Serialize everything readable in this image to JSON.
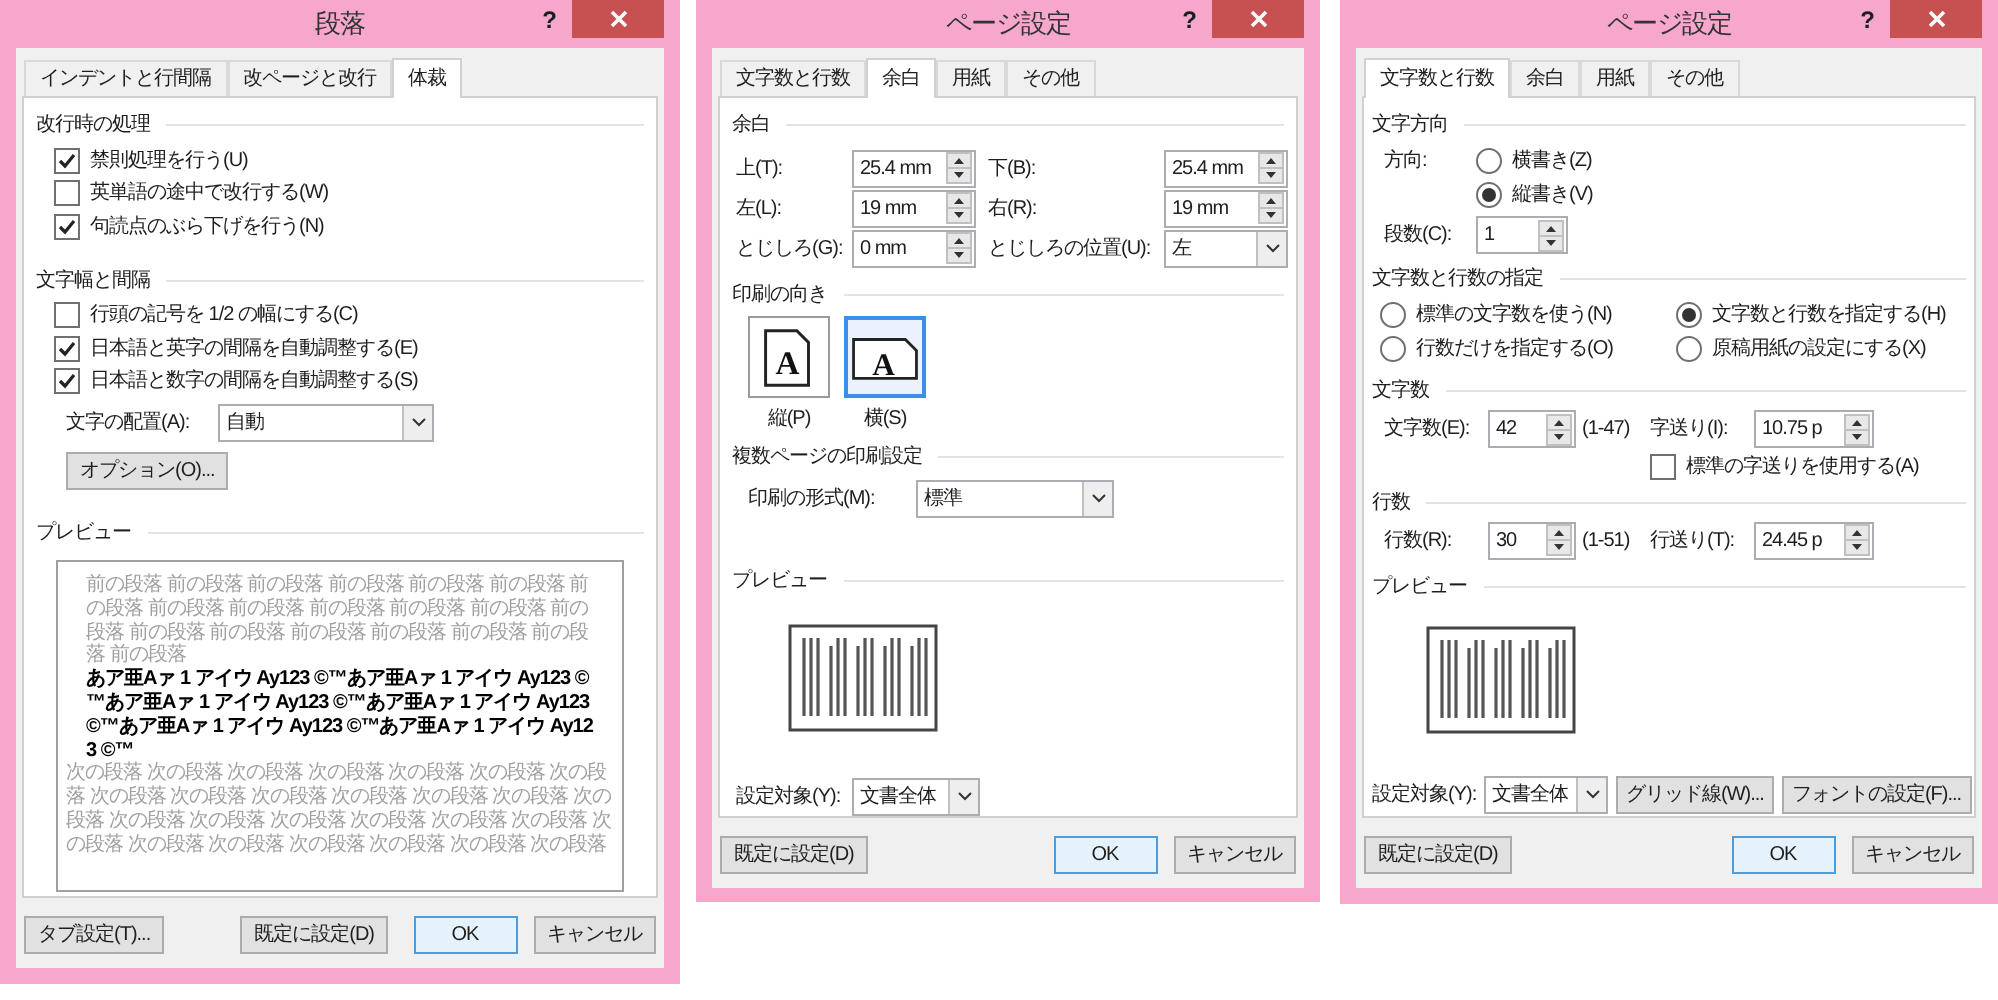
{
  "paragraph_dialog": {
    "title": "段落",
    "help": "?",
    "tabs": [
      {
        "label": "インデントと行間隔",
        "selected": false
      },
      {
        "label": "改ページと改行",
        "selected": false
      },
      {
        "label": "体裁",
        "selected": true
      }
    ],
    "line_break": {
      "heading": "改行時の処理",
      "options": [
        {
          "label": "禁則処理を行う(U)",
          "checked": true
        },
        {
          "label": "英単語の途中で改行する(W)",
          "checked": false
        },
        {
          "label": "句読点のぶら下げを行う(N)",
          "checked": true
        }
      ]
    },
    "width_spacing": {
      "heading": "文字幅と間隔",
      "options": [
        {
          "label": "行頭の記号を 1/2 の幅にする(C)",
          "checked": false
        },
        {
          "label": "日本語と英字の間隔を自動調整する(E)",
          "checked": true
        },
        {
          "label": "日本語と数字の間隔を自動調整する(S)",
          "checked": true
        }
      ]
    },
    "alignment": {
      "label": "文字の配置(A):",
      "value": "自動"
    },
    "option_button": "オプション(O)...",
    "preview": {
      "heading": "プレビュー",
      "before": "前の段落 前の段落 前の段落 前の段落 前の段落 前の段落 前の段落 前の段落 前の段落 前の段落 前の段落 前の段落 前の段落 前の段落 前の段落 前の段落 前の段落 前の段落 前の段落 前の段落",
      "sample": "あア亜Aァ 1 アイウ Ay123 ©™あア亜Aァ 1 アイウ Ay123 ©™あア亜Aァ 1 アイウ Ay123 ©™あア亜Aァ 1 アイウ Ay123 ©™あア亜Aァ 1 アイウ Ay123 ©™あア亜Aァ 1 アイウ Ay123 ©™",
      "after": "次の段落 次の段落 次の段落 次の段落 次の段落 次の段落 次の段落 次の段落 次の段落 次の段落 次の段落 次の段落 次の段落 次の段落 次の段落 次の段落 次の段落 次の段落 次の段落 次の段落 次の段落 次の段落 次の段落 次の段落 次の段落 次の段落 次の段落"
    },
    "buttons": [
      {
        "label": "タブ設定(T)...",
        "kind": "normal"
      },
      {
        "label": "既定に設定(D)",
        "kind": "normal"
      },
      {
        "label": "OK",
        "kind": "default"
      },
      {
        "label": "キャンセル",
        "kind": "normal"
      }
    ]
  },
  "margins_dialog": {
    "title": "ページ設定",
    "help": "?",
    "tabs": [
      {
        "label": "文字数と行数",
        "selected": false
      },
      {
        "label": "余白",
        "selected": true
      },
      {
        "label": "用紙",
        "selected": false
      },
      {
        "label": "その他",
        "selected": false
      }
    ],
    "margins": {
      "heading": "余白",
      "fields": [
        {
          "label": "上(T):",
          "value": "25.4 mm",
          "kind": "spin"
        },
        {
          "label": "下(B):",
          "value": "25.4 mm",
          "kind": "spin"
        },
        {
          "label": "左(L):",
          "value": "19 mm",
          "kind": "spin"
        },
        {
          "label": "右(R):",
          "value": "19 mm",
          "kind": "spin"
        },
        {
          "label": "とじしろ(G):",
          "value": "0 mm",
          "kind": "spin"
        },
        {
          "label": "とじしろの位置(U):",
          "value": "左",
          "kind": "select"
        }
      ]
    },
    "orientation": {
      "heading": "印刷の向き",
      "options": [
        {
          "label": "縦(P)",
          "glyph": "A",
          "kind": "portrait",
          "selected": false
        },
        {
          "label": "横(S)",
          "glyph": "A",
          "kind": "landscape",
          "selected": true
        }
      ]
    },
    "multiple_pages": {
      "heading": "複数ページの印刷設定",
      "label": "印刷の形式(M):",
      "value": "標準"
    },
    "preview": {
      "heading": "プレビュー"
    },
    "apply_to": {
      "label": "設定対象(Y):",
      "value": "文書全体"
    },
    "buttons": [
      {
        "label": "既定に設定(D)",
        "kind": "normal"
      },
      {
        "label": "OK",
        "kind": "default"
      },
      {
        "label": "キャンセル",
        "kind": "normal"
      }
    ]
  },
  "grid_dialog": {
    "title": "ページ設定",
    "help": "?",
    "tabs": [
      {
        "label": "文字数と行数",
        "selected": true
      },
      {
        "label": "余白",
        "selected": false
      },
      {
        "label": "用紙",
        "selected": false
      },
      {
        "label": "その他",
        "selected": false
      }
    ],
    "direction": {
      "heading": "文字方向",
      "label": "方向:",
      "options": [
        {
          "label": "横書き(Z)",
          "selected": false
        },
        {
          "label": "縦書き(V)",
          "selected": true
        }
      ],
      "columns_label": "段数(C):",
      "columns_value": "1"
    },
    "grid": {
      "heading": "文字数と行数の指定",
      "options": [
        {
          "label": "標準の文字数を使う(N)",
          "selected": false
        },
        {
          "label": "文字数と行数を指定する(H)",
          "selected": true
        },
        {
          "label": "行数だけを指定する(O)",
          "selected": false
        },
        {
          "label": "原稿用紙の設定にする(X)",
          "selected": false
        }
      ]
    },
    "characters": {
      "heading": "文字数",
      "label": "文字数(E):",
      "value": "42",
      "range": "(1-47)",
      "pitch_label": "字送り(I):",
      "pitch_value": "10.75 p",
      "standard_pitch": {
        "label": "標準の字送りを使用する(A)",
        "checked": false
      }
    },
    "lines": {
      "heading": "行数",
      "label": "行数(R):",
      "value": "30",
      "range": "(1-51)",
      "pitch_label": "行送り(T):",
      "pitch_value": "24.45 p"
    },
    "preview": {
      "heading": "プレビュー"
    },
    "apply_to": {
      "label": "設定対象(Y):",
      "value": "文書全体"
    },
    "tool_buttons": [
      "グリッド線(W)...",
      "フォントの設定(F)..."
    ],
    "buttons": [
      {
        "label": "既定に設定(D)",
        "kind": "normal"
      },
      {
        "label": "OK",
        "kind": "default"
      },
      {
        "label": "キャンセル",
        "kind": "normal"
      }
    ]
  }
}
